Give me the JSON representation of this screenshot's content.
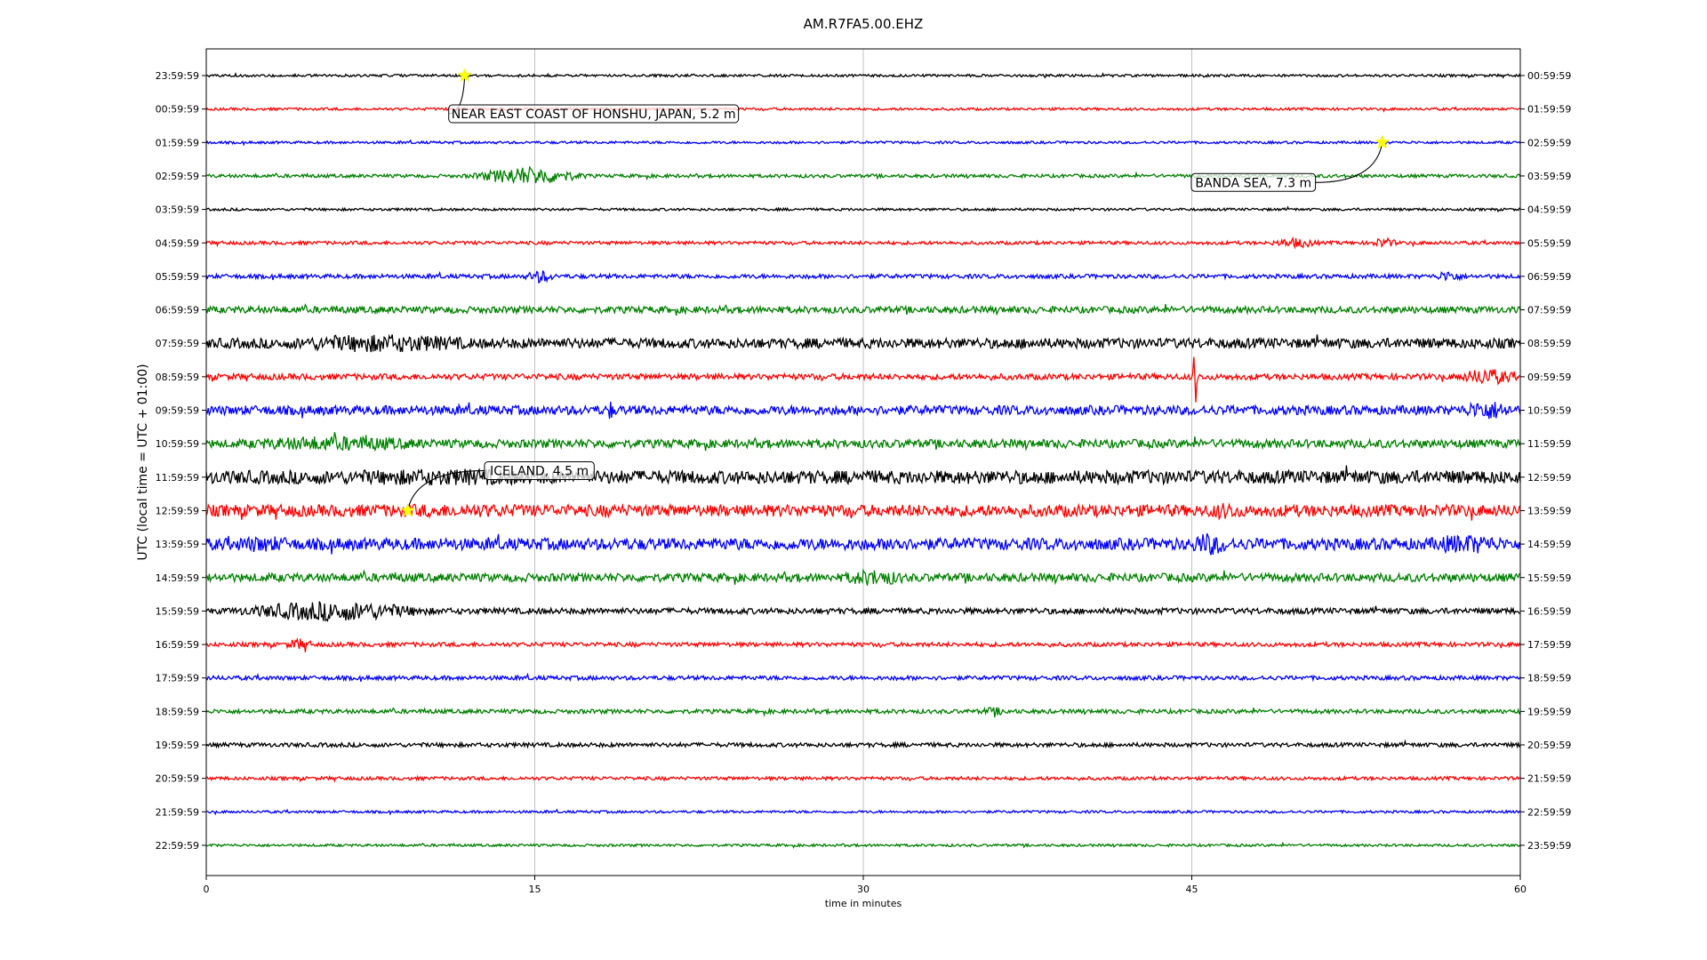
{
  "chart_data": {
    "type": "line",
    "title": "AM.R7FA5.00.EHZ",
    "xlabel": "time in minutes",
    "ylabel": "UTC (local time = UTC + 01:00)",
    "xlim": [
      0,
      60
    ],
    "x_ticks": [
      0,
      15,
      30,
      45,
      60
    ],
    "grid_x": true,
    "colors": [
      "#000000",
      "#ff0000",
      "#0000ff",
      "#008000"
    ],
    "rows": [
      {
        "left": "23:59:59",
        "right": "00:59:59",
        "level": 0.15,
        "color": "#000000"
      },
      {
        "left": "00:59:59",
        "right": "01:59:59",
        "level": 0.15,
        "color": "#ff0000"
      },
      {
        "left": "01:59:59",
        "right": "02:59:59",
        "level": 0.15,
        "color": "#0000ff"
      },
      {
        "left": "02:59:59",
        "right": "03:59:59",
        "level": 0.2,
        "color": "#008000"
      },
      {
        "left": "03:59:59",
        "right": "04:59:59",
        "level": 0.15,
        "color": "#000000"
      },
      {
        "left": "04:59:59",
        "right": "05:59:59",
        "level": 0.2,
        "color": "#ff0000"
      },
      {
        "left": "05:59:59",
        "right": "06:59:59",
        "level": 0.25,
        "color": "#0000ff"
      },
      {
        "left": "06:59:59",
        "right": "07:59:59",
        "level": 0.4,
        "color": "#008000"
      },
      {
        "left": "07:59:59",
        "right": "08:59:59",
        "level": 0.6,
        "color": "#000000"
      },
      {
        "left": "08:59:59",
        "right": "09:59:59",
        "level": 0.35,
        "color": "#ff0000"
      },
      {
        "left": "09:59:59",
        "right": "10:59:59",
        "level": 0.55,
        "color": "#0000ff"
      },
      {
        "left": "10:59:59",
        "right": "11:59:59",
        "level": 0.5,
        "color": "#008000"
      },
      {
        "left": "11:59:59",
        "right": "12:59:59",
        "level": 0.8,
        "color": "#000000"
      },
      {
        "left": "12:59:59",
        "right": "13:59:59",
        "level": 0.7,
        "color": "#ff0000"
      },
      {
        "left": "13:59:59",
        "right": "14:59:59",
        "level": 0.7,
        "color": "#0000ff"
      },
      {
        "left": "14:59:59",
        "right": "15:59:59",
        "level": 0.5,
        "color": "#008000"
      },
      {
        "left": "15:59:59",
        "right": "16:59:59",
        "level": 0.35,
        "color": "#000000"
      },
      {
        "left": "16:59:59",
        "right": "17:59:59",
        "level": 0.25,
        "color": "#ff0000"
      },
      {
        "left": "17:59:59",
        "right": "18:59:59",
        "level": 0.25,
        "color": "#0000ff"
      },
      {
        "left": "18:59:59",
        "right": "19:59:59",
        "level": 0.25,
        "color": "#008000"
      },
      {
        "left": "19:59:59",
        "right": "20:59:59",
        "level": 0.25,
        "color": "#000000"
      },
      {
        "left": "20:59:59",
        "right": "21:59:59",
        "level": 0.2,
        "color": "#ff0000"
      },
      {
        "left": "21:59:59",
        "right": "22:59:59",
        "level": 0.15,
        "color": "#0000ff"
      },
      {
        "left": "22:59:59",
        "right": "23:59:59",
        "level": 0.15,
        "color": "#008000"
      }
    ],
    "bursts": [
      {
        "row": 3,
        "x": 12.2,
        "width": 5.0,
        "amp": 1.1
      },
      {
        "row": 5,
        "x": 48.5,
        "width": 2.5,
        "amp": 0.6
      },
      {
        "row": 5,
        "x": 53.0,
        "width": 1.5,
        "amp": 0.6
      },
      {
        "row": 6,
        "x": 14.5,
        "width": 1.5,
        "amp": 0.8
      },
      {
        "row": 6,
        "x": 56.0,
        "width": 1.5,
        "amp": 0.7
      },
      {
        "row": 8,
        "x": 2.0,
        "width": 12.0,
        "amp": 1.1
      },
      {
        "row": 8,
        "x": 37.0,
        "width": 1.0,
        "amp": 0.8
      },
      {
        "row": 9,
        "x": 45.1,
        "width": 0.1,
        "amp": 3.5
      },
      {
        "row": 9,
        "x": 57.0,
        "width": 3.0,
        "amp": 1.0
      },
      {
        "row": 10,
        "x": 57.0,
        "width": 3.0,
        "amp": 1.2
      },
      {
        "row": 10,
        "x": 18.3,
        "width": 0.3,
        "amp": 1.3
      },
      {
        "row": 11,
        "x": 0.0,
        "width": 12.0,
        "amp": 0.9
      },
      {
        "row": 12,
        "x": 1.0,
        "width": 20.0,
        "amp": 1.0
      },
      {
        "row": 13,
        "x": 0.0,
        "width": 22.0,
        "amp": 0.8
      },
      {
        "row": 13,
        "x": 45.0,
        "width": 3.0,
        "amp": 1.0
      },
      {
        "row": 14,
        "x": 0.0,
        "width": 5.0,
        "amp": 1.0
      },
      {
        "row": 14,
        "x": 31.0,
        "width": 1.0,
        "amp": 1.3
      },
      {
        "row": 14,
        "x": 44.5,
        "width": 2.5,
        "amp": 1.4
      },
      {
        "row": 14,
        "x": 55.0,
        "width": 5.0,
        "amp": 1.2
      },
      {
        "row": 15,
        "x": 28.5,
        "width": 4.0,
        "amp": 1.0
      },
      {
        "row": 16,
        "x": 1.0,
        "width": 9.5,
        "amp": 1.2
      },
      {
        "row": 17,
        "x": 3.5,
        "width": 1.5,
        "amp": 0.7
      },
      {
        "row": 19,
        "x": 35.0,
        "width": 2.0,
        "amp": 0.5
      }
    ],
    "events": [
      {
        "label": "NEAR EAST COAST OF HONSHU, JAPAN, 5.2 m",
        "row": 0,
        "x": 11.8
      },
      {
        "label": "BANDA SEA, 7.3 m",
        "row": 2,
        "x": 53.7
      },
      {
        "label": "ICELAND, 4.5 m",
        "row": 13,
        "x": 9.2
      }
    ],
    "marker_color": "#ffff00"
  }
}
